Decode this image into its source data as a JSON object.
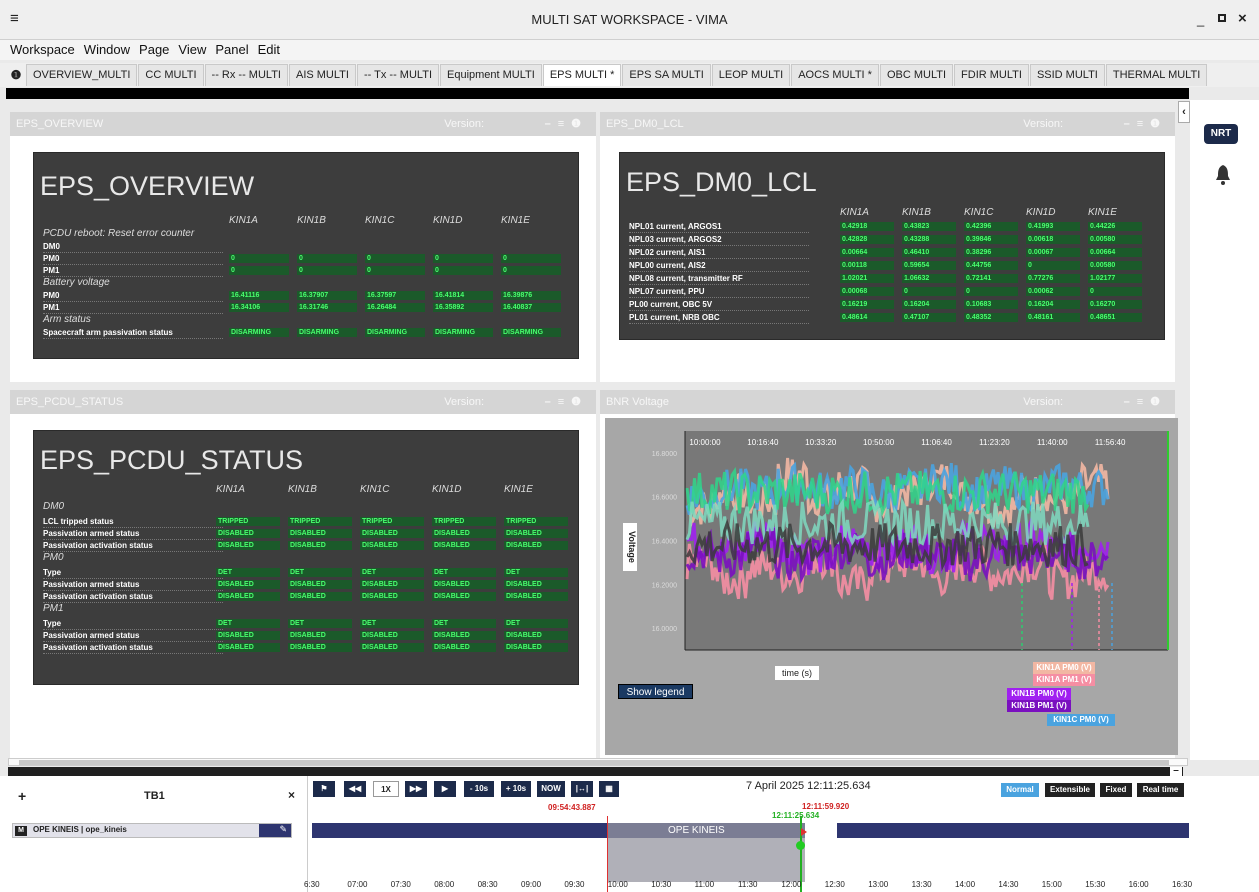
{
  "window": {
    "title": "MULTI SAT WORKSPACE - VIMA"
  },
  "menu": [
    "Workspace",
    "Window",
    "Page",
    "View",
    "Panel",
    "Edit"
  ],
  "tabs": [
    "OVERVIEW_MULTI",
    "CC MULTI",
    "-- Rx -- MULTI",
    "AIS MULTI",
    "-- Tx -- MULTI",
    "Equipment MULTI",
    "EPS MULTI *",
    "EPS SA MULTI",
    "LEOP MULTI",
    "AOCS MULTI *",
    "OBC MULTI",
    "FDIR MULTI",
    "SSID MULTI",
    "THERMAL MULTI"
  ],
  "active_tab": "EPS MULTI *",
  "right": {
    "nrt": "NRT"
  },
  "panels": {
    "overview": {
      "header": "EPS_OVERVIEW",
      "version": "Version:",
      "title": "EPS_OVERVIEW",
      "cols": [
        "KIN1A",
        "KIN1B",
        "KIN1C",
        "KIN1D",
        "KIN1E"
      ],
      "sections": [
        {
          "name": "PCDU reboot: Reset error counter",
          "rows": [
            {
              "label": "DM0",
              "values": [
                "",
                "",
                "",
                "",
                ""
              ]
            },
            {
              "label": "PM0",
              "values": [
                "0",
                "0",
                "0",
                "0",
                "0"
              ]
            },
            {
              "label": "PM1",
              "values": [
                "0",
                "0",
                "0",
                "0",
                "0"
              ]
            }
          ]
        },
        {
          "name": "Battery voltage",
          "rows": [
            {
              "label": "PM0",
              "values": [
                "16.41116",
                "16.37907",
                "16.37597",
                "16.41814",
                "16.39876"
              ]
            },
            {
              "label": "PM1",
              "values": [
                "16.34106",
                "16.31746",
                "16.26484",
                "16.35892",
                "16.40837"
              ]
            }
          ]
        },
        {
          "name": "Arm status",
          "rows": [
            {
              "label": "Spacecraft arm passivation status",
              "values": [
                "DISARMING",
                "DISARMING",
                "DISARMING",
                "DISARMING",
                "DISARMING"
              ]
            }
          ]
        }
      ]
    },
    "lcl": {
      "header": "EPS_DM0_LCL",
      "version": "Version:",
      "title": "EPS_DM0_LCL",
      "cols": [
        "KIN1A",
        "KIN1B",
        "KIN1C",
        "KIN1D",
        "KIN1E"
      ],
      "rows": [
        {
          "label": "NPL01 current, ARGOS1",
          "values": [
            "0.42918",
            "0.43823",
            "0.42396",
            "0.41993",
            "0.44226"
          ]
        },
        {
          "label": "NPL03 current, ARGOS2",
          "values": [
            "0.42828",
            "0.43288",
            "0.39846",
            "0.00618",
            "0.00580"
          ]
        },
        {
          "label": "NPL02 current, AIS1",
          "values": [
            "0.00664",
            "0.46410",
            "0.38296",
            "0.00067",
            "0.00664"
          ]
        },
        {
          "label": "NPL00 current, AIS2",
          "values": [
            "0.00118",
            "0.59654",
            "0.44756",
            "0",
            "0.00580"
          ]
        },
        {
          "label": "NPL08 current, transmitter RF",
          "values": [
            "1.02021",
            "1.06632",
            "0.72141",
            "0.77276",
            "1.02177"
          ]
        },
        {
          "label": "NPL07 current, PPU",
          "values": [
            "0.00068",
            "0",
            "0",
            "0.00062",
            "0"
          ]
        },
        {
          "label": "PL00 current, OBC 5V",
          "values": [
            "0.16219",
            "0.16204",
            "0.10683",
            "0.16204",
            "0.16270"
          ]
        },
        {
          "label": "PL01 current, NRB OBC",
          "values": [
            "0.48614",
            "0.47107",
            "0.48352",
            "0.48161",
            "0.48651"
          ]
        }
      ]
    },
    "pcdu": {
      "header": "EPS_PCDU_STATUS",
      "version": "Version:",
      "title": "EPS_PCDU_STATUS",
      "cols": [
        "KIN1A",
        "KIN1B",
        "KIN1C",
        "KIN1D",
        "KIN1E"
      ],
      "sections": [
        {
          "name": "DM0",
          "rows": [
            {
              "label": "LCL tripped status",
              "values": [
                "TRIPPED",
                "TRIPPED",
                "TRIPPED",
                "TRIPPED",
                "TRIPPED"
              ]
            },
            {
              "label": "Passivation armed status",
              "values": [
                "DISABLED",
                "DISABLED",
                "DISABLED",
                "DISABLED",
                "DISABLED"
              ]
            },
            {
              "label": "Passivation activation status",
              "values": [
                "DISABLED",
                "DISABLED",
                "DISABLED",
                "DISABLED",
                "DISABLED"
              ]
            }
          ]
        },
        {
          "name": "PM0",
          "rows": [
            {
              "label": "Type",
              "values": [
                "DET",
                "DET",
                "DET",
                "DET",
                "DET"
              ]
            },
            {
              "label": "Passivation armed status",
              "values": [
                "DISABLED",
                "DISABLED",
                "DISABLED",
                "DISABLED",
                "DISABLED"
              ]
            },
            {
              "label": "Passivation activation status",
              "values": [
                "DISABLED",
                "DISABLED",
                "DISABLED",
                "DISABLED",
                "DISABLED"
              ]
            }
          ]
        },
        {
          "name": "PM1",
          "rows": [
            {
              "label": "Type",
              "values": [
                "DET",
                "DET",
                "DET",
                "DET",
                "DET"
              ]
            },
            {
              "label": "Passivation armed status",
              "values": [
                "DISABLED",
                "DISABLED",
                "DISABLED",
                "DISABLED",
                "DISABLED"
              ]
            },
            {
              "label": "Passivation activation status",
              "values": [
                "DISABLED",
                "DISABLED",
                "DISABLED",
                "DISABLED",
                "DISABLED"
              ]
            }
          ]
        }
      ]
    },
    "bnr": {
      "header": "BNR Voltage",
      "version": "Version:"
    }
  },
  "chart_data": {
    "type": "line",
    "ylabel": "Voltage",
    "xlabel": "time (s)",
    "x_ticks": [
      "10:00:00",
      "10:16:40",
      "10:33:20",
      "10:50:00",
      "11:06:40",
      "11:23:20",
      "11:40:00",
      "11:56:40"
    ],
    "y_ticks": [
      "16.8000",
      "16.6000",
      "16.4000",
      "16.2000",
      "16.0000"
    ],
    "ylim": [
      15.9,
      16.9
    ],
    "legend": [
      {
        "name": "KIN1A PM0 (V)",
        "color": "#f2b7a3"
      },
      {
        "name": "KIN1A PM1 (V)",
        "color": "#f58ea3"
      },
      {
        "name": "KIN1B PM0 (V)",
        "color": "#a020f0"
      },
      {
        "name": "KIN1B PM1 (V)",
        "color": "#7a0fbf"
      },
      {
        "name": "KIN1C PM0 (V)",
        "color": "#4aa3df"
      }
    ],
    "series": [
      {
        "name": "KIN1A PM0 (V)",
        "color": "#f2b7a3",
        "values": [
          16.55,
          16.62,
          16.58,
          16.7,
          16.6,
          16.65,
          16.57,
          16.63,
          16.68,
          16.6,
          16.55,
          16.62,
          16.59,
          16.66,
          16.6
        ]
      },
      {
        "name": "KIN1A PM1 (V)",
        "color": "#f58ea3",
        "values": [
          16.3,
          16.22,
          16.28,
          16.25,
          16.32,
          16.2,
          16.27,
          16.3,
          16.23,
          16.29,
          16.25,
          16.3,
          16.22,
          16.26,
          16.24
        ]
      },
      {
        "name": "KIN1B PM0 (V)",
        "color": "#a020f0",
        "values": [
          16.4,
          16.35,
          16.42,
          16.38,
          16.33,
          16.4,
          16.36,
          16.39,
          16.34,
          16.41,
          16.37,
          16.4,
          16.35,
          16.38,
          16.36
        ]
      },
      {
        "name": "KIN1B PM1 (V)",
        "color": "#7a0fbf",
        "values": [
          16.35,
          16.32,
          16.37,
          16.3,
          16.34,
          16.36,
          16.31,
          16.35,
          16.33,
          16.3,
          16.36,
          16.32,
          16.34,
          16.31,
          16.33
        ]
      },
      {
        "name": "KIN1C PM0 (V)",
        "color": "#4aa3df",
        "values": [
          16.6,
          16.64,
          16.62,
          16.66,
          16.63,
          16.65,
          16.61,
          16.64,
          16.67,
          16.62,
          16.65,
          16.63,
          16.66,
          16.64,
          16.65
        ]
      }
    ]
  },
  "chart_button": "Show legend",
  "timeline": {
    "tb": "TB1",
    "row_badge": "M",
    "row_label": "OPE KINEIS | ope_kineis",
    "buttons": [
      "1X",
      "- 10s",
      "+ 10s",
      "NOW"
    ],
    "date": "7 April 2025 12:11:25.634",
    "t_left": "09:54:43.887",
    "t_right": "12:11:59.920",
    "t_current": "12:11:25.634",
    "bar_label": "OPE KINEIS",
    "modes": [
      "Normal",
      "Extensible",
      "Fixed",
      "Real time"
    ],
    "ticks": [
      "6:30",
      "07:00",
      "07:30",
      "08:00",
      "08:30",
      "09:00",
      "09:30",
      "10:00",
      "10:30",
      "11:00",
      "11:30",
      "12:00",
      "12:30",
      "13:00",
      "13:30",
      "14:00",
      "14:30",
      "15:00",
      "15:30",
      "16:00",
      "16:30"
    ]
  }
}
